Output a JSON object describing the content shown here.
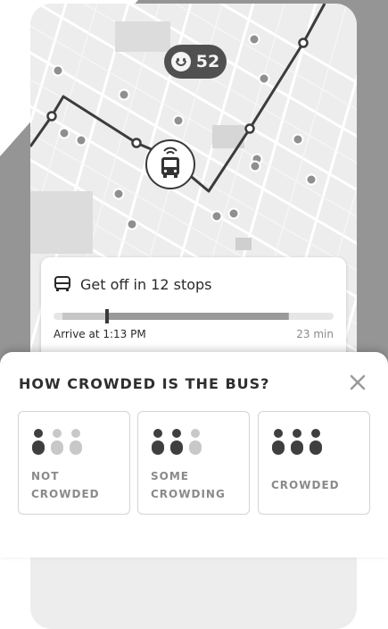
{
  "rider_count": {
    "value": "52",
    "icon": "smiley-face-icon"
  },
  "trip": {
    "title": "Get off in 12 stops",
    "icon": "bus-icon",
    "arrive": "Arrive at 1:13 PM",
    "eta": "23 min",
    "progress_fraction": 0.84
  },
  "sheet": {
    "title": "HOW CROWDED IS THE BUS?",
    "close_icon": "close-icon"
  },
  "options": [
    {
      "line1": "NOT",
      "line2": "CROWDED",
      "level": 1
    },
    {
      "line1": "SOME",
      "line2": "CROWDING",
      "level": 2
    },
    {
      "line1": "CROWDED",
      "line2": "",
      "level": 3
    }
  ],
  "colors": {
    "background_gray": "#959595",
    "map": "#ededed",
    "route": "#3c3c3c",
    "dot_filled": "#3f3f3f",
    "dot_empty": "#c8c8c8",
    "label": "#8a8a8a"
  }
}
